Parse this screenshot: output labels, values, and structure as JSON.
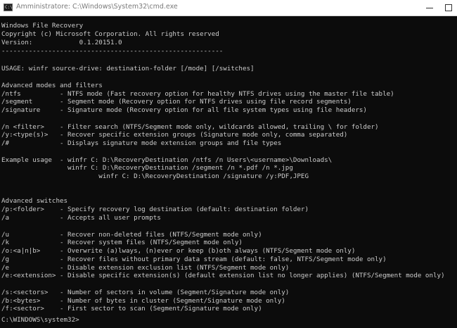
{
  "window": {
    "title": "Amministratore: C:\\Windows\\System32\\cmd.exe",
    "icon_text": "C:\\",
    "icon": "cmd-icon"
  },
  "console": {
    "lines": [
      "Windows File Recovery",
      "Copyright (c) Microsoft Corporation. All rights reserved",
      "Version:            0.1.20151.0",
      "---------------------------------------------------------",
      "",
      "USAGE: winfr source-drive: destination-folder [/mode] [/switches]",
      "",
      "Advanced modes and filters",
      "/ntfs          - NTFS mode (Fast recovery option for healthy NTFS drives using the master file table)",
      "/segment       - Segment mode (Recovery option for NTFS drives using file record segments)",
      "/signature     - Signature mode (Recovery option for all file system types using file headers)",
      "",
      "/n <filter>    - Filter search (NTFS/Segment mode only, wildcards allowed, trailing \\ for folder)",
      "/y:<type(s)>   - Recover specific extension groups (Signature mode only, comma separated)",
      "/#             - Displays signature mode extension groups and file types",
      "",
      "Example usage  - winfr C: D:\\RecoveryDestination /ntfs /n Users\\<username>\\Downloads\\",
      "                 winfr C: D:\\RecoveryDestination /segment /n *.pdf /n *.jpg",
      "                         winfr C: D:\\RecoveryDestination /signature /y:PDF,JPEG",
      "",
      "",
      "Advanced switches",
      "/p:<folder>    - Specify recovery log destination (default: destination folder)",
      "/a             - Accepts all user prompts",
      "",
      "/u             - Recover non-deleted files (NTFS/Segment mode only)",
      "/k             - Recover system files (NTFS/Segment mode only)",
      "/o:<a|n|b>     - Overwrite (a)lways, (n)ever or keep (b)oth always (NTFS/Segment mode only)",
      "/g             - Recover files without primary data stream (default: false, NTFS/Segment mode only)",
      "/e             - Disable extension exclusion list (NTFS/Segment mode only)",
      "/e:<extension> - Disable specific extension(s) (default extension list no longer applies) (NTFS/Segment mode only)",
      "",
      "/s:<sectors>   - Number of sectors in volume (Segment/Signature mode only)",
      "/b:<bytes>     - Number of bytes in cluster (Segment/Signature mode only)",
      "/f:<sector>    - First sector to scan (Segment/Signature mode only)",
      "",
      "",
      "C:\\WINDOWS\\system32>"
    ]
  },
  "colors": {
    "background": "#0c0c0c",
    "text": "#cccccc",
    "titlebar": "#ffffff",
    "title_text": "#7a7a7a"
  }
}
